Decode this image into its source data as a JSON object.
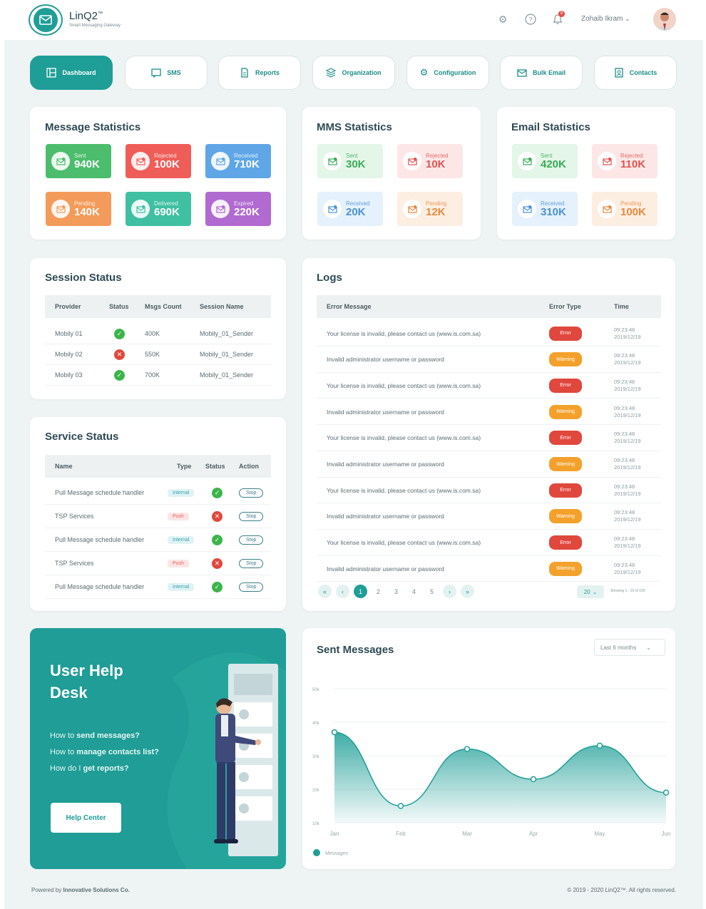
{
  "app": {
    "name": "LinQ2",
    "trademark": "™",
    "tagline": "Smart Messaging Gateway"
  },
  "topbar": {
    "user_name": "Zohaib Ikram",
    "notification_count": "8"
  },
  "nav": [
    {
      "label": "Dashboard",
      "icon": "dashboard-icon",
      "active": true
    },
    {
      "label": "SMS",
      "icon": "sms-icon"
    },
    {
      "label": "Reports",
      "icon": "reports-icon"
    },
    {
      "label": "Organization",
      "icon": "organization-icon"
    },
    {
      "label": "Configuration",
      "icon": "gear-icon"
    },
    {
      "label": "Bulk Email",
      "icon": "email-icon"
    },
    {
      "label": "Contacts",
      "icon": "contacts-icon"
    }
  ],
  "message_stats": {
    "title": "Message Statistics",
    "tiles": [
      {
        "label": "Sent",
        "value": "940K",
        "color": "#4cbd6c"
      },
      {
        "label": "Rejected",
        "value": "100K",
        "color": "#ef5d58"
      },
      {
        "label": "Received",
        "value": "710K",
        "color": "#5fa6e6"
      },
      {
        "label": "Pending",
        "value": "140K",
        "color": "#f39b5a"
      },
      {
        "label": "Delivered",
        "value": "690K",
        "color": "#3fc0a2"
      },
      {
        "label": "Expired",
        "value": "220K",
        "color": "#b06ad0"
      }
    ]
  },
  "mms_stats": {
    "title": "MMS Statistics",
    "tiles": [
      {
        "label": "Sent",
        "value": "30K",
        "bg": "#e3f6e8",
        "color": "#3aaa58"
      },
      {
        "label": "Rejected",
        "value": "10K",
        "bg": "#fde7e6",
        "color": "#e05450"
      },
      {
        "label": "Received",
        "value": "20K",
        "bg": "#e5f1fc",
        "color": "#4a92d6"
      },
      {
        "label": "Pending",
        "value": "12K",
        "bg": "#fdeee2",
        "color": "#e88a3e"
      }
    ]
  },
  "email_stats": {
    "title": "Email Statistics",
    "tiles": [
      {
        "label": "Sent",
        "value": "420K",
        "bg": "#e3f6e8",
        "color": "#3aaa58"
      },
      {
        "label": "Rejected",
        "value": "110K",
        "bg": "#fde7e6",
        "color": "#e05450"
      },
      {
        "label": "Received",
        "value": "310K",
        "bg": "#e5f1fc",
        "color": "#4a92d6"
      },
      {
        "label": "Pending",
        "value": "100K",
        "bg": "#fdeee2",
        "color": "#e88a3e"
      }
    ]
  },
  "session_status": {
    "title": "Session Status",
    "headers": [
      "Provider",
      "Status",
      "Msgs Count",
      "Session Name"
    ],
    "rows": [
      {
        "provider": "Mobily 01",
        "status": "ok",
        "count": "400K",
        "session": "Mobily_01_Sender"
      },
      {
        "provider": "Mobily 02",
        "status": "bad",
        "count": "550K",
        "session": "Mobily_01_Sender"
      },
      {
        "provider": "Mobily 03",
        "status": "ok",
        "count": "700K",
        "session": "Mobily_01_Sender"
      }
    ]
  },
  "service_status": {
    "title": "Service Status",
    "headers": [
      "Name",
      "Type",
      "Status",
      "Action"
    ],
    "rows": [
      {
        "name": "Pull Message schedule handler",
        "type": "Internal",
        "status": "ok",
        "action": "Stop"
      },
      {
        "name": "TSP Services",
        "type": "Push",
        "status": "bad",
        "action": "Stop"
      },
      {
        "name": "Pull Message schedule handler",
        "type": "Internal",
        "status": "ok",
        "action": "Stop"
      },
      {
        "name": "TSP Services",
        "type": "Push",
        "status": "bad",
        "action": "Stop"
      },
      {
        "name": "Pull Message schedule handler",
        "type": "Internal",
        "status": "ok",
        "action": "Stop"
      }
    ]
  },
  "logs": {
    "title": "Logs",
    "headers": [
      "Error Message",
      "Error Type",
      "Time"
    ],
    "rows": [
      {
        "message": "Your license is invalid, please contact us (www.is.com.sa)",
        "type": "Error",
        "time": "09:23:48",
        "date": "2019/12/19"
      },
      {
        "message": "Invalid administrator username or password",
        "type": "Warning",
        "time": "09:23:48",
        "date": "2019/12/19"
      },
      {
        "message": "Your license is invalid, please contact us (www.is.com.sa)",
        "type": "Error",
        "time": "09:23:48",
        "date": "2019/12/19"
      },
      {
        "message": "Invalid administrator username or password",
        "type": "Warning",
        "time": "09:23:48",
        "date": "2019/12/19"
      },
      {
        "message": "Your license is invalid, please contact us (www.is.com.sa)",
        "type": "Error",
        "time": "09:23:48",
        "date": "2019/12/19"
      },
      {
        "message": "Invalid administrator username or password",
        "type": "Warning",
        "time": "09:23:48",
        "date": "2019/12/19"
      },
      {
        "message": "Your license is invalid, please contact us (www.is.com.sa)",
        "type": "Error",
        "time": "09:23:48",
        "date": "2019/12/19"
      },
      {
        "message": "Invalid administrator username or password",
        "type": "Warning",
        "time": "09:23:48",
        "date": "2019/12/19"
      },
      {
        "message": "Your license is invalid, please contact us (www.is.com.sa)",
        "type": "Error",
        "time": "09:23:48",
        "date": "2019/12/19"
      },
      {
        "message": "Invalid administrator username or password",
        "type": "Warning",
        "time": "09:23:48",
        "date": "2019/12/19"
      }
    ],
    "pagination": {
      "first": "«",
      "prev": "‹",
      "pages": [
        "1",
        "2",
        "3",
        "4",
        "5"
      ],
      "current": "1",
      "next": "›",
      "last": "»",
      "page_size": "20",
      "showing": "Showing 1 - 20 of 100"
    }
  },
  "help": {
    "title_line1": "User Help",
    "title_line2": "Desk",
    "q1_pre": "How to ",
    "q1_bold": "send messages?",
    "q2_pre": "How to ",
    "q2_bold": "manage contacts list?",
    "q3_pre": "How do I ",
    "q3_bold": "get reports?",
    "button": "Help Center"
  },
  "sent_messages": {
    "title": "Sent Messages",
    "range_select": "Last 6 months"
  },
  "chart_data": {
    "type": "area",
    "title": "Sent Messages",
    "categories": [
      "Jan",
      "Feb",
      "Mar",
      "Apr",
      "May",
      "Jun"
    ],
    "series": [
      {
        "name": "Messages",
        "values": [
          37,
          15,
          32,
          23,
          33,
          19
        ]
      }
    ],
    "yticks": [
      "10k",
      "20k",
      "30k",
      "40k",
      "50k"
    ],
    "ylim": [
      10,
      50
    ],
    "color": "#1e9e97",
    "grid": true,
    "legend": "bottom-left"
  },
  "footer": {
    "left_pre": "Powered by ",
    "left_bold": "Innovative Solutions Co.",
    "right": "© 2019 - 2020 LinQ2™. All rights reserved."
  }
}
